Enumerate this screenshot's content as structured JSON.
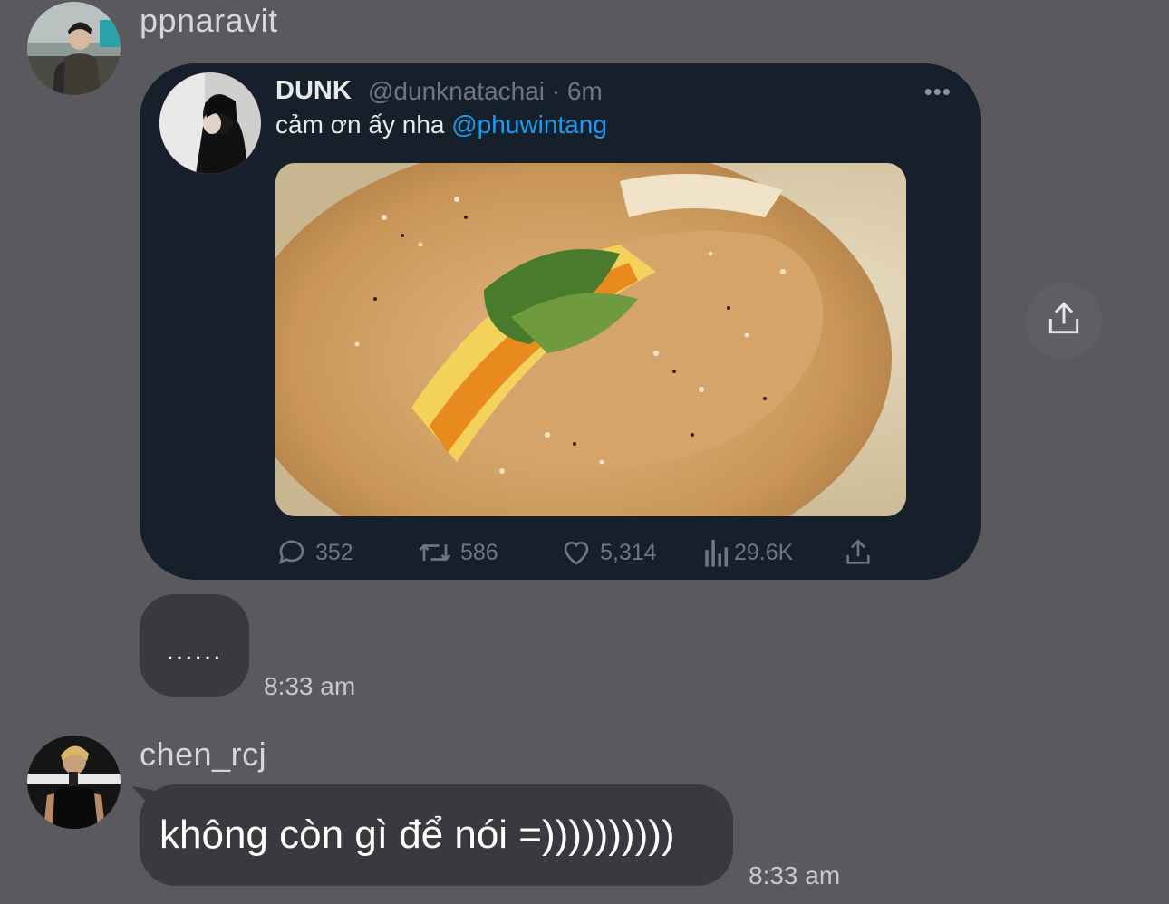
{
  "messages": [
    {
      "sender": "ppnaravit",
      "tweet": {
        "name": "DUNK",
        "handle": "@dunknatachai · 6m",
        "text": "cảm ơn ấy nha",
        "mention": "@phuwintang",
        "more": "•••",
        "stats": {
          "replies": "352",
          "retweets": "586",
          "likes": "5,314",
          "views": "29.6K"
        }
      },
      "text": "......",
      "time": "8:33 am"
    },
    {
      "sender": "chen_rcj",
      "text": "không còn gì để nói =))))))))))",
      "time": "8:33 am"
    }
  ],
  "icons": {
    "share_outer": "share-icon",
    "reply": "reply-icon",
    "retweet": "retweet-icon",
    "like": "heart-icon",
    "views": "views-icon",
    "share": "share-icon"
  },
  "colors": {
    "background": "#5a595e",
    "bubble": "#3a393d",
    "tweet_card": "#16202b",
    "mention": "#1d9bf0"
  }
}
